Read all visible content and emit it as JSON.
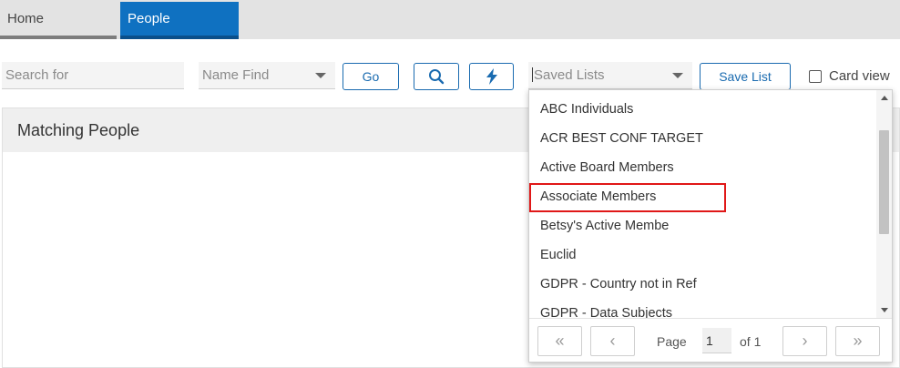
{
  "tabs": {
    "home": "Home",
    "people": "People"
  },
  "toolbar": {
    "search_placeholder": "Search for",
    "name_find": "Name Find",
    "go_label": "Go",
    "saved_lists_placeholder": "Saved Lists",
    "save_list_label": "Save List",
    "card_view_label": "Card view"
  },
  "panel": {
    "title": "Matching People"
  },
  "dropdown": {
    "options": [
      "ABC Individuals",
      "ACR BEST CONF TARGET",
      "Active Board Members",
      "Associate Members",
      "Betsy's Active Membe",
      "Euclid",
      "GDPR - Country not in Ref",
      "GDPR - Data Subjects"
    ],
    "highlighted": "Associate Members",
    "pager": {
      "page_label": "Page",
      "page_value": "1",
      "of_label": "of 1"
    }
  },
  "icons": {
    "search": "search-icon",
    "bolt": "lightning-icon"
  },
  "colors": {
    "accent": "#0f71c1",
    "highlight": "#e01818"
  }
}
